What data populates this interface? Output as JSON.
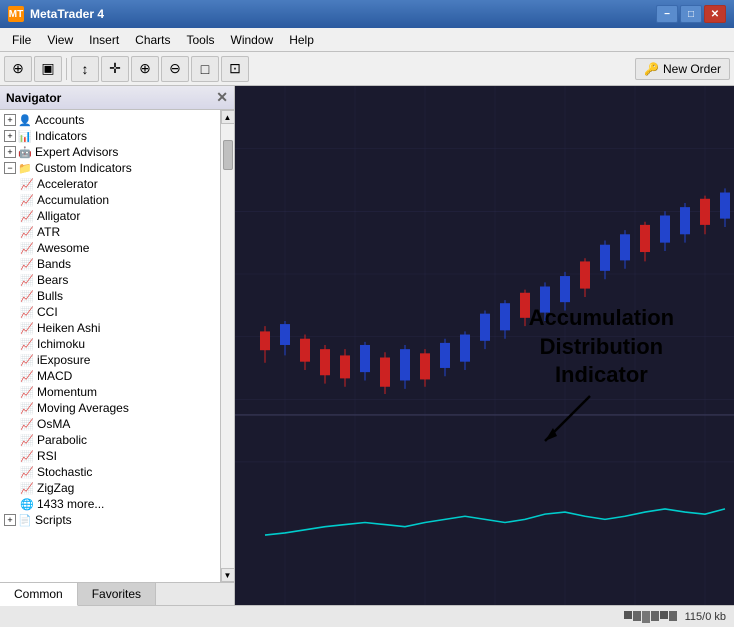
{
  "titlebar": {
    "title": "MetaTrader 4",
    "icon": "MT",
    "minimize": "−",
    "maximize": "□",
    "close": "✕"
  },
  "menubar": {
    "items": [
      "File",
      "View",
      "Insert",
      "Charts",
      "Tools",
      "Window",
      "Help"
    ]
  },
  "toolbar": {
    "new_order_label": "New Order",
    "buttons": [
      "⊕",
      "▣",
      "↕",
      "✛",
      "→",
      "□",
      "⊡",
      "⊞"
    ]
  },
  "navigator": {
    "title": "Navigator",
    "close": "✕",
    "tree": {
      "accounts": "Accounts",
      "indicators": "Indicators",
      "expert_advisors": "Expert Advisors",
      "custom_indicators": "Custom Indicators",
      "items": [
        "Accelerator",
        "Accumulation",
        "Alligator",
        "ATR",
        "Awesome",
        "Bands",
        "Bears",
        "Bulls",
        "CCI",
        "Heiken Ashi",
        "Ichimoku",
        "iExposure",
        "MACD",
        "Momentum",
        "Moving Averages",
        "OsMA",
        "Parabolic",
        "RSI",
        "Stochastic",
        "ZigZag",
        "1433 more..."
      ],
      "scripts": "Scripts"
    },
    "tabs": [
      "Common",
      "Favorites"
    ]
  },
  "chart": {
    "annotation": {
      "line1": "Accumulation",
      "line2": "Distribution",
      "line3": "Indicator"
    }
  },
  "statusbar": {
    "kb_label": "115/0 kb"
  }
}
